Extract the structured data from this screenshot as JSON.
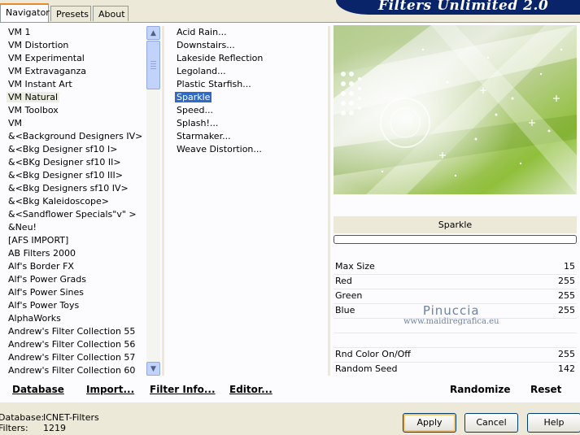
{
  "tabs": [
    "Navigator",
    "Presets",
    "About"
  ],
  "title": "Filters Unlimited 2.0",
  "categories": [
    "VM 1",
    "VM Distortion",
    "VM Experimental",
    "VM Extravaganza",
    "VM Instant Art",
    "VM Natural",
    "VM Toolbox",
    "VM",
    "&<Background Designers IV>",
    "&<Bkg Designer sf10 I>",
    "&<BKg Designer sf10 II>",
    "&<Bkg Designer sf10 III>",
    "&<Bkg Designers sf10 IV>",
    "&<Bkg Kaleidoscope>",
    "&<Sandflower Specials\"v\" >",
    "&Neu!",
    "[AFS IMPORT]",
    "AB Filters 2000",
    "Alf's Border FX",
    "Alf's Power Grads",
    "Alf's Power Sines",
    "Alf's Power Toys",
    "AlphaWorks",
    "Andrew's Filter Collection 55",
    "Andrew's Filter Collection 56",
    "Andrew's Filter Collection 57",
    "Andrew's Filter Collection 60"
  ],
  "selected_category": "VM Natural",
  "filters": [
    "Acid Rain...",
    "Downstairs...",
    "Lakeside Reflection",
    "Legoland...",
    "Plastic Starfish...",
    "Sparkle",
    "Speed...",
    "Splash!...",
    "Starmaker...",
    "Weave Distortion..."
  ],
  "selected_filter": "Sparkle",
  "preview_title": "Sparkle",
  "parameters": [
    {
      "name": "Max Size",
      "value": "15"
    },
    {
      "name": "Red",
      "value": "255"
    },
    {
      "name": "Green",
      "value": "255"
    },
    {
      "name": "Blue",
      "value": "255"
    },
    {
      "name": "",
      "value": ""
    },
    {
      "name": "",
      "value": ""
    },
    {
      "name": "Rnd Color On/Off",
      "value": "255"
    },
    {
      "name": "Random Seed",
      "value": "142"
    }
  ],
  "watermark": {
    "line1": "Pinuccia",
    "line2": "www.maidiregrafica.eu"
  },
  "toolbar": {
    "database": "Database",
    "import": "Import...",
    "filter_info": "Filter Info...",
    "editor": "Editor...",
    "randomize": "Randomize",
    "reset": "Reset"
  },
  "status": {
    "database_label": "Database:",
    "database_value": "ICNET-Filters",
    "filters_label": "Filters:",
    "filters_value": "1219"
  },
  "buttons": {
    "apply": "Apply",
    "cancel": "Cancel",
    "help": "Help"
  },
  "colors": {
    "accent": "#316ac5",
    "banner": "#0a246a",
    "dialog": "#ece9d8",
    "tab_highlight": "#e68b2c",
    "preview_green": "#8fbf3a"
  }
}
